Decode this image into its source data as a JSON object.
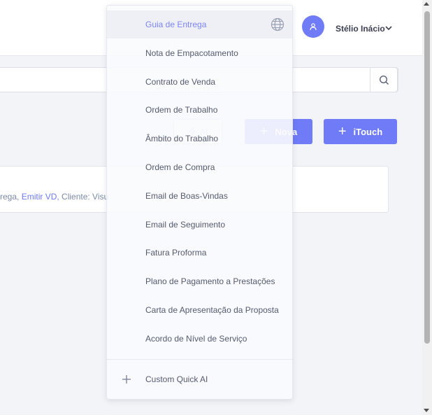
{
  "header": {
    "user_name": "Stélio Inácio",
    "icons": {
      "avatar": "user-icon",
      "chevron": "chevron-down-icon"
    }
  },
  "search": {
    "value": "",
    "icon": "search-icon"
  },
  "toolbar": {
    "ai_label": "AI",
    "nova_label": "Nova",
    "itouch_label": "iTouch",
    "colors": {
      "accent": "#6f7bf7"
    }
  },
  "card": {
    "text_prefix": "rega,",
    "link_label": "Emitir VD,",
    "text_suffix": " Cliente: Visu"
  },
  "quick_ai_menu": {
    "items": [
      {
        "label": "Guia de Entrega",
        "active": true
      },
      {
        "label": "Nota de Empacotamento"
      },
      {
        "label": "Contrato de Venda"
      },
      {
        "label": "Ordem de Trabalho"
      },
      {
        "label": "Âmbito do Trabalho"
      },
      {
        "label": "Ordem de Compra"
      },
      {
        "label": "Email de Boas-Vindas"
      },
      {
        "label": "Email de Seguimento"
      },
      {
        "label": "Fatura Proforma"
      },
      {
        "label": "Plano de Pagamento a Prestações"
      },
      {
        "label": "Carta de Apresentação da Proposta"
      },
      {
        "label": "Acordo de Nível de Serviço"
      }
    ],
    "custom_label": "Custom Quick AI",
    "icons": {
      "language": "globe-icon",
      "custom": "plus-icon"
    }
  }
}
